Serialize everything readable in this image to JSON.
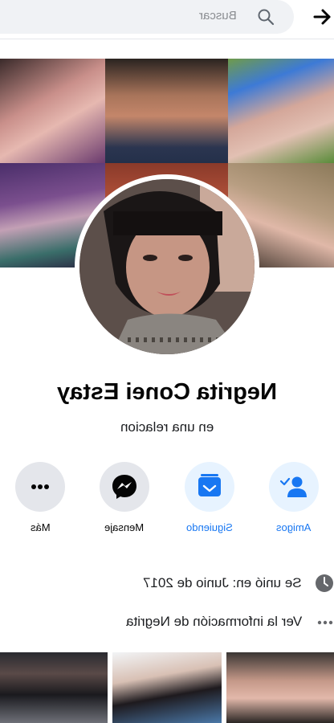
{
  "search": {
    "placeholder": "Buscar"
  },
  "profile": {
    "name": "Negrita Conei Estay",
    "relationship": "en una relacion"
  },
  "actions": [
    {
      "label": "Amigos",
      "icon": "add-friend-icon",
      "color": "#1877f2"
    },
    {
      "label": "Siguiendo",
      "icon": "following-icon",
      "color": "#1877f2"
    },
    {
      "label": "Mensaje",
      "icon": "messenger-icon",
      "color": "#050505"
    },
    {
      "label": "Más",
      "icon": "more-icon",
      "color": "#050505"
    }
  ],
  "info": {
    "joined": "Se unió en: Junio de 2017",
    "see_info": "Ver la información de Negrita"
  },
  "colors": {
    "accent": "#1877f2",
    "button_bg_light": "#e7f3ff",
    "button_bg_gray": "#e4e6eb"
  }
}
